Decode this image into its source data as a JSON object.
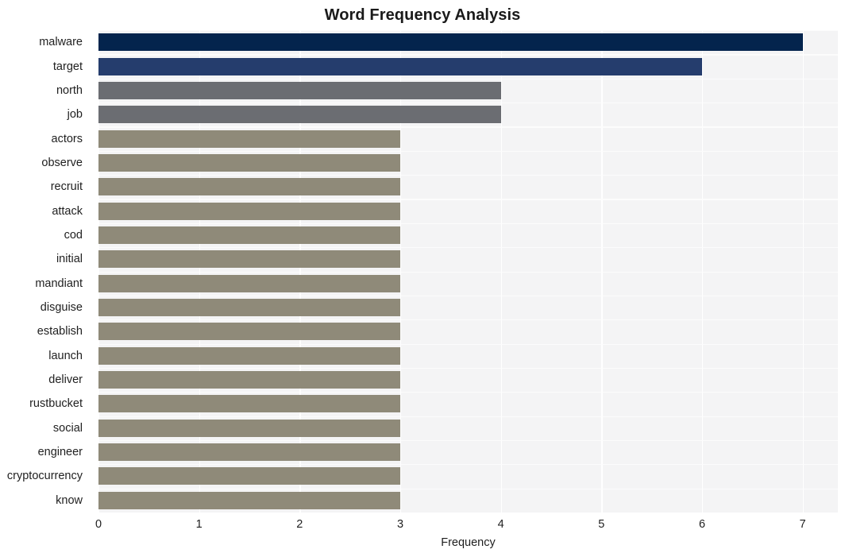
{
  "chart_data": {
    "type": "bar",
    "orientation": "horizontal",
    "title": "Word Frequency Analysis",
    "xlabel": "Frequency",
    "ylabel": "",
    "xlim": [
      0,
      7.35
    ],
    "xticks": [
      0,
      1,
      2,
      3,
      4,
      5,
      6,
      7
    ],
    "xticklabels": [
      "0",
      "1",
      "2",
      "3",
      "4",
      "5",
      "6",
      "7"
    ],
    "grid": true,
    "legend": null,
    "categories": [
      "malware",
      "target",
      "north",
      "job",
      "actors",
      "observe",
      "recruit",
      "attack",
      "cod",
      "initial",
      "mandiant",
      "disguise",
      "establish",
      "launch",
      "deliver",
      "rustbucket",
      "social",
      "engineer",
      "cryptocurrency",
      "know"
    ],
    "values": [
      7,
      6,
      4,
      4,
      3,
      3,
      3,
      3,
      3,
      3,
      3,
      3,
      3,
      3,
      3,
      3,
      3,
      3,
      3,
      3
    ],
    "bar_colors": [
      "#04244d",
      "#253d6d",
      "#6b6d72",
      "#6b6d72",
      "#8f8a79",
      "#8f8a79",
      "#8f8a79",
      "#8f8a79",
      "#8f8a79",
      "#8f8a79",
      "#8f8a79",
      "#8f8a79",
      "#8f8a79",
      "#8f8a79",
      "#8f8a79",
      "#8f8a79",
      "#8f8a79",
      "#8f8a79",
      "#8f8a79",
      "#8f8a79"
    ],
    "plot_background": "#f4f4f5",
    "figure_background": "#ffffff",
    "gridline_color": "#ffffff",
    "text_color": "#1f1f1f"
  }
}
